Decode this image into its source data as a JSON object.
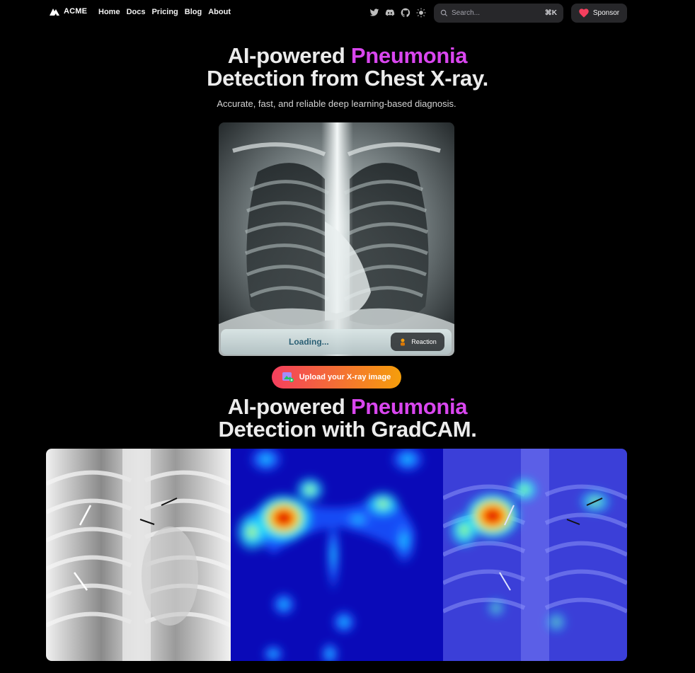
{
  "nav": {
    "brand": "ACME",
    "links": [
      "Home",
      "Docs",
      "Pricing",
      "Blog",
      "About"
    ],
    "social_icons": [
      "twitter-icon",
      "discord-icon",
      "github-icon",
      "theme-toggle-icon"
    ],
    "search_placeholder": "Search...",
    "search_shortcut": "⌘K",
    "sponsor_label": "Sponsor"
  },
  "hero": {
    "title_prefix": "AI-powered ",
    "title_accent": "Pneumonia",
    "title_line2": "Detection from Chest X-ray.",
    "subtitle": "Accurate, fast, and reliable deep learning-based diagnosis."
  },
  "preview": {
    "status_text": "Loading...",
    "reaction_label": "Reaction"
  },
  "upload": {
    "label": "Upload your X-ray image"
  },
  "gradcam": {
    "title_prefix": "AI-powered ",
    "title_accent": "Pneumonia",
    "title_line2": "Detection with GradCAM."
  },
  "colors": {
    "accent": "#d946ef",
    "upload_gradient_start": "#f43f5e",
    "upload_gradient_end": "#f59e0b",
    "sponsor_heart": "#f43f5e"
  }
}
